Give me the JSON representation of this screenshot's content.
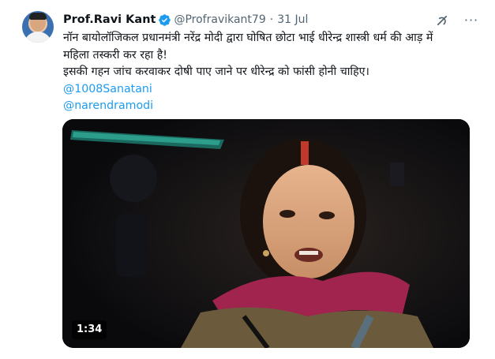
{
  "tweet": {
    "author_name": "Prof.Ravi Kant",
    "handle": "@Profravikant79",
    "separator": "·",
    "date": "31 Jul",
    "text_lines": [
      "नॉन बायोलॉजिकल प्रधानमंत्री नरेंद्र मोदी द्वारा घोषित छोटा भाई धीरेन्द्र शास्त्री धर्म की आड़ में",
      "महिला तस्करी कर रहा है!",
      "इसकी गहन जांच करवाकर दोषी पाए जाने पर धीरेन्द्र को फांसी होनी चाहिए।"
    ],
    "mentions": [
      "@1008Sanatani",
      "@narendramodi"
    ],
    "video_duration": "1:34",
    "more_label": "···"
  },
  "icons": {
    "verified": "verified-badge-icon",
    "grok": "grok-icon",
    "more": "more-icon",
    "avatar": "avatar"
  },
  "colors": {
    "link": "#1d9bf0",
    "verified": "#1d9bf0",
    "text": "#0f1419",
    "secondary": "#536471"
  }
}
